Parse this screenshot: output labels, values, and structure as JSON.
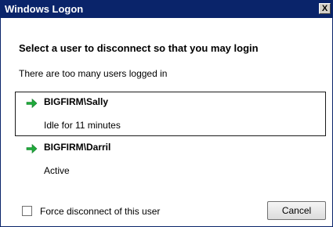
{
  "window": {
    "title": "Windows Logon",
    "close_glyph": "X"
  },
  "heading": "Select a user to disconnect so that you may login",
  "subtext": "There are too many users logged in",
  "users": [
    {
      "name": "BIGFIRM\\Sally",
      "status": "Idle for 11 minutes",
      "selected": true,
      "icon": "green-arrow-icon"
    },
    {
      "name": "BIGFIRM\\Darril",
      "status": "Active",
      "selected": false,
      "icon": "green-arrow-icon"
    }
  ],
  "force_disconnect": {
    "label": "Force disconnect of this user",
    "checked": false
  },
  "buttons": {
    "cancel_label": "Cancel"
  },
  "colors": {
    "titlebar": "#0a246a",
    "arrow": "#1faa3b"
  }
}
